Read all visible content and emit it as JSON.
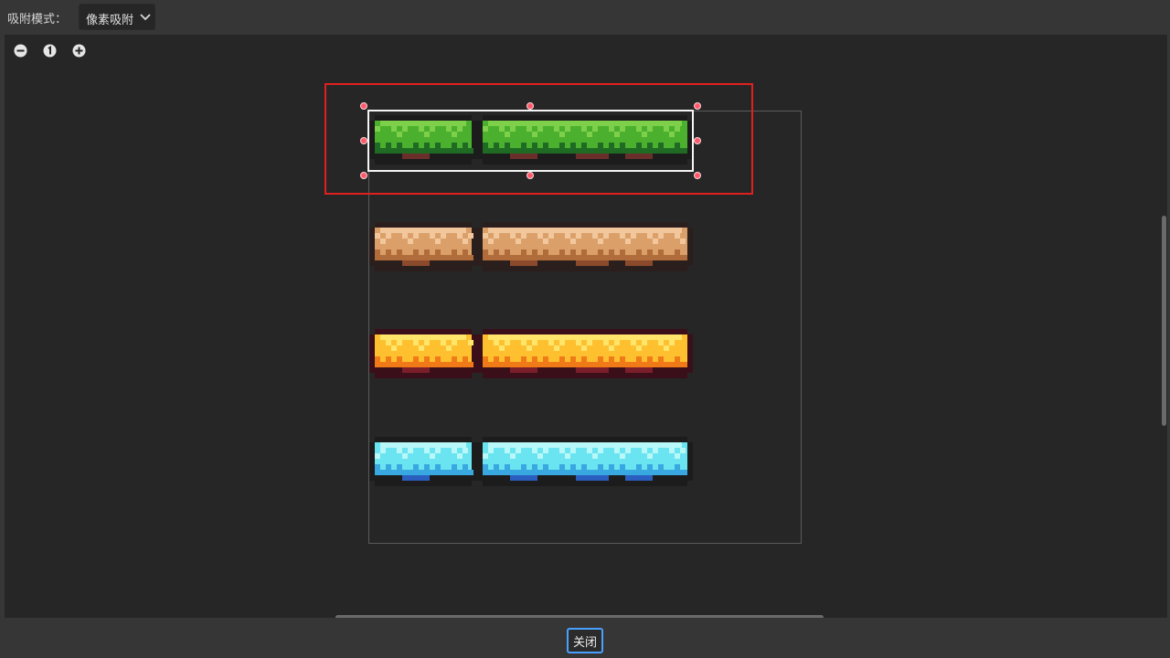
{
  "toolbar": {
    "snap_mode_label": "吸附模式：",
    "snap_mode_value": "像素吸附"
  },
  "icons": {
    "zoom_out": "zoom-out-icon",
    "zoom_reset": "zoom-reset-icon",
    "zoom_in": "zoom-in-icon",
    "dropdown": "chevron-down-icon"
  },
  "colors": {
    "selection_red": "#e0201f",
    "selection_white": "#f5f5f5",
    "handle": "#ff5a6b",
    "focus_blue": "#4aa0ff"
  },
  "tilesheet": {
    "rows": [
      {
        "name": "grass",
        "top": "#7ed04a",
        "mid": "#4bb02e",
        "dark": "#1f6b24",
        "base": "#6a2f2a",
        "shadow": "#1c1c1c"
      },
      {
        "name": "sand",
        "top": "#f3c79c",
        "mid": "#dba06a",
        "dark": "#b06c3b",
        "base": "#8b4a2b",
        "shadow": "#2a1f1c"
      },
      {
        "name": "lava",
        "top": "#ffe56a",
        "mid": "#ffc030",
        "dark": "#f07a18",
        "base": "#7a1e2a",
        "shadow": "#3a0f1a"
      },
      {
        "name": "ice",
        "top": "#b8f8f8",
        "mid": "#6ae4f0",
        "dark": "#3aa8e0",
        "base": "#2a5fc0",
        "shadow": "#1c1c1c"
      }
    ]
  },
  "footer": {
    "close_label": "关闭"
  }
}
